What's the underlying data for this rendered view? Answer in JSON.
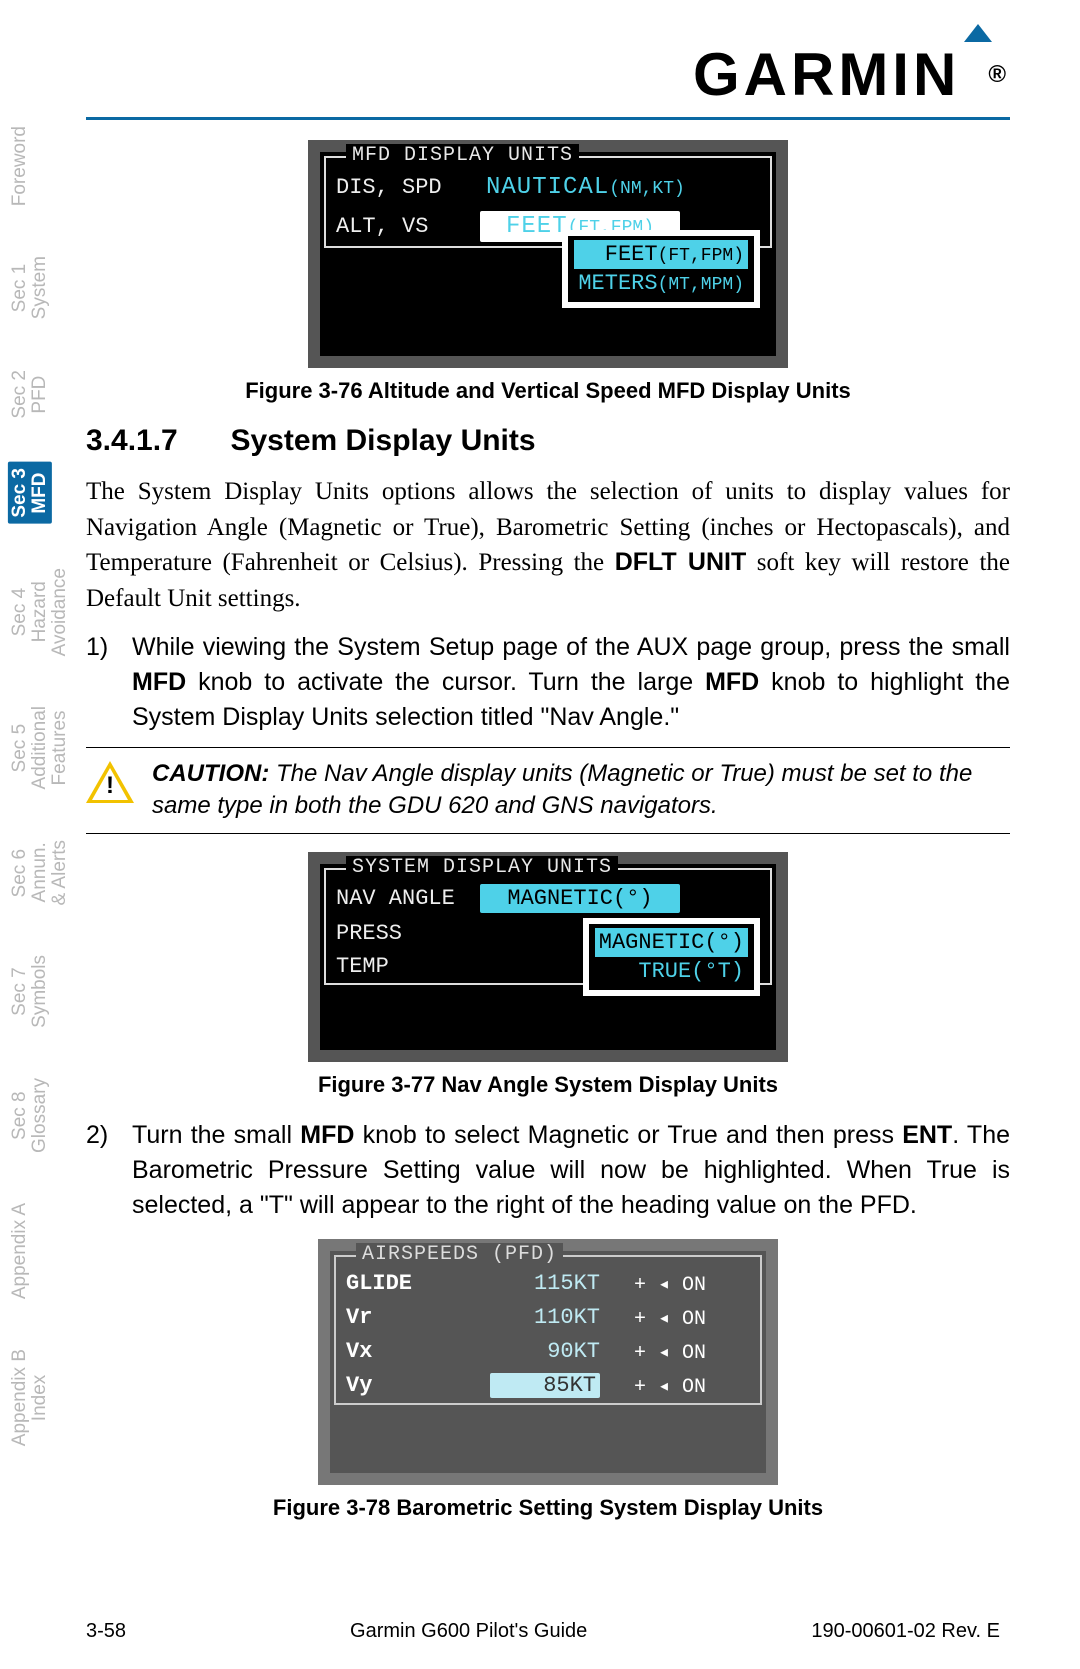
{
  "brand": "GARMIN",
  "side_tabs": [
    {
      "label": "Foreword"
    },
    {
      "label": "Sec 1\nSystem"
    },
    {
      "label": "Sec 2\nPFD"
    },
    {
      "label": "Sec 3\nMFD",
      "active": true
    },
    {
      "label": "Sec 4\nHazard\nAvoidance"
    },
    {
      "label": "Sec 5\nAdditional\nFeatures"
    },
    {
      "label": "Sec 6\nAnnun.\n& Alerts"
    },
    {
      "label": "Sec 7\nSymbols"
    },
    {
      "label": "Sec 8\nGlossary"
    },
    {
      "label": "Appendix A"
    },
    {
      "label": "Appendix B\nIndex"
    }
  ],
  "fig1": {
    "box_title": "MFD DISPLAY UNITS",
    "row1_label": "DIS, SPD",
    "row1_value": "NAUTICAL",
    "row1_units": "(NM,KT)",
    "row2_label": "ALT, VS",
    "row2_value": "FEET",
    "row2_units": "(FT,FPM)",
    "popup": [
      {
        "value": "FEET",
        "units": "(FT,FPM)",
        "selected": true
      },
      {
        "value": "METERS",
        "units": "(MT,MPM)",
        "selected": false
      }
    ],
    "caption": "Figure 3-76  Altitude and Vertical Speed MFD Display Units"
  },
  "heading": {
    "num": "3.4.1.7",
    "title": "System Display Units"
  },
  "para1_a": "The System Display Units options allows the selection of units to display values for Navigation Angle (Magnetic or True), Barometric Setting (inches or Hectopascals), and Temperature (Fahrenheit or Celsius). Pressing the ",
  "para1_b": "DFLT UNIT",
  "para1_c": " soft key will restore the Default Unit settings.",
  "step1_num": "1)",
  "step1_a": "While viewing the System Setup page of the AUX page group, press the small ",
  "step1_b": "MFD",
  "step1_c": " knob to activate the cursor. Turn the large ",
  "step1_d": "MFD",
  "step1_e": " knob to highlight the System Display Units selection titled \"Nav Angle.\"",
  "caution_label": "CAUTION:",
  "caution_text": " The Nav Angle display units (Magnetic or True) must be set to the same type in both the GDU 620 and GNS navigators.",
  "fig2": {
    "box_title": "SYSTEM DISPLAY UNITS",
    "row1_label": "NAV ANGLE",
    "row1_value": "MAGNETIC(°)",
    "row2_label": "PRESS",
    "row3_label": "TEMP",
    "popup": [
      {
        "text": "MAGNETIC(°)",
        "selected": true
      },
      {
        "text": "TRUE(°T)",
        "selected": false
      }
    ],
    "caption": "Figure 3-77  Nav Angle System Display Units"
  },
  "step2_num": "2)",
  "step2_a": "Turn the small ",
  "step2_b": "MFD",
  "step2_c": " knob to select Magnetic or True and then press ",
  "step2_d": "ENT",
  "step2_e": ". The Barometric Pressure Setting value will now be highlighted. When True is selected, a \"T\" will appear to the right of the heading value on the PFD.",
  "fig3": {
    "box_title": "AIRSPEEDS (PFD)",
    "rows": [
      {
        "label": "GLIDE",
        "value": "115KT",
        "suffix": "+ ◂ ON"
      },
      {
        "label": "Vr",
        "value": "110KT",
        "suffix": "+ ◂ ON"
      },
      {
        "label": "Vx",
        "value": "90KT",
        "suffix": "+ ◂ ON"
      },
      {
        "label": "Vy",
        "value": "85KT",
        "suffix": "+ ◂ ON",
        "selected": true
      }
    ],
    "caption": "Figure 3-78  Barometric Setting System Display Units"
  },
  "footer": {
    "left": "3-58",
    "center": "Garmin G600 Pilot's Guide",
    "right": "190-00601-02  Rev. E"
  }
}
